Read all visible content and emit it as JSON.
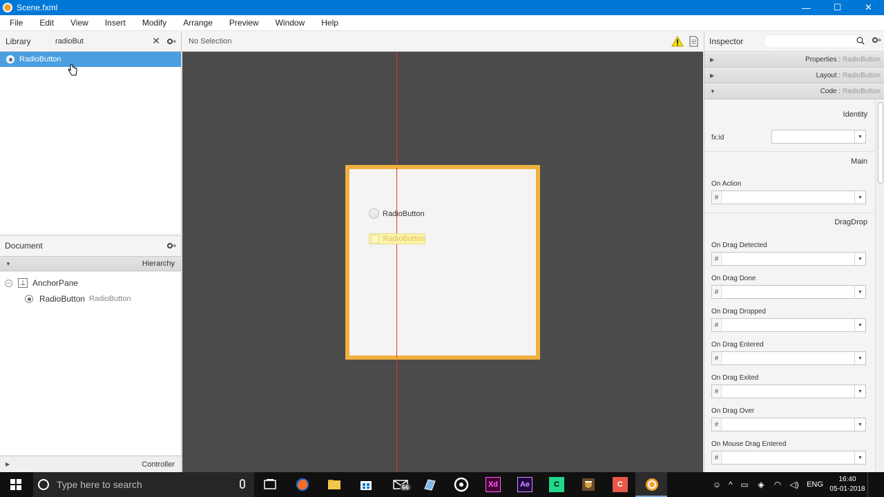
{
  "window": {
    "title": "Scene.fxml",
    "controls": {
      "minimize": "—",
      "maximize": "☐",
      "close": "✕"
    }
  },
  "menu": [
    "File",
    "Edit",
    "View",
    "Insert",
    "Modify",
    "Arrange",
    "Preview",
    "Window",
    "Help"
  ],
  "library": {
    "label": "Library",
    "search_value": "radioBut",
    "results": [
      "RadioButton"
    ]
  },
  "document": {
    "label": "Document",
    "hierarchy_label": "Hierarchy",
    "tree": [
      {
        "name": "AnchorPane",
        "type": ""
      },
      {
        "name": "RadioButton",
        "type": "RadioButton"
      }
    ],
    "controller_label": "Controller"
  },
  "canvas": {
    "selection_text": "No Selection",
    "radio_label": "RadioButton",
    "ghost_label": "RadioButton"
  },
  "inspector": {
    "label": "Inspector",
    "sections": [
      {
        "name": "Properties",
        "sub": "RadioButton",
        "expanded": false
      },
      {
        "name": "Layout",
        "sub": "RadioButton",
        "expanded": false
      },
      {
        "name": "Code",
        "sub": "RadioButton",
        "expanded": true
      }
    ],
    "identity_title": "Identity",
    "fxid_label": "fx:id",
    "main_title": "Main",
    "on_action_label": "On Action",
    "dragdrop_title": "DragDrop",
    "hash": "#",
    "events": [
      "On Drag Detected",
      "On Drag Done",
      "On Drag Dropped",
      "On Drag Entered",
      "On Drag Exited",
      "On Drag Over",
      "On Mouse Drag Entered"
    ]
  },
  "taskbar": {
    "search_placeholder": "Type here to search",
    "mail_badge": "66",
    "language": "ENG",
    "time": "16:40",
    "date": "05-01-2018"
  },
  "colors": {
    "titlebar": "#0078d7",
    "selection": "#4a9fe0",
    "anchor_border": "#f0b040",
    "guide_line": "#e8322a",
    "canvas_bg": "#4b4b4b"
  }
}
